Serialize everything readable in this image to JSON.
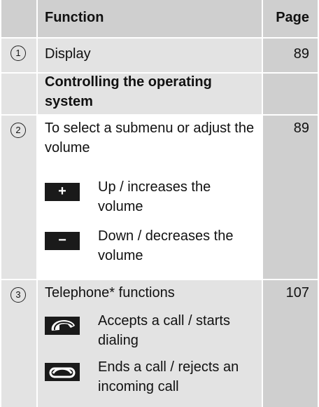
{
  "header": {
    "function": "Function",
    "page": "Page"
  },
  "rows": [
    {
      "num": "1",
      "text": "Display",
      "page": "89"
    },
    {
      "section": "Controlling the operating system"
    },
    {
      "num": "2",
      "text": "To select a submenu or adjust the volume",
      "page": "89",
      "subs": [
        {
          "key": "+",
          "text": "Up / increases the volume"
        },
        {
          "key": "−",
          "text": "Down / decreases the volume"
        }
      ]
    },
    {
      "num": "3",
      "text": "Telephone* functions",
      "page": "107",
      "subs": [
        {
          "icon": "phone-accept-icon",
          "text": "Accepts a call / starts dialing"
        },
        {
          "icon": "phone-end-icon",
          "text": "Ends a call / rejects an incoming call"
        }
      ]
    }
  ]
}
